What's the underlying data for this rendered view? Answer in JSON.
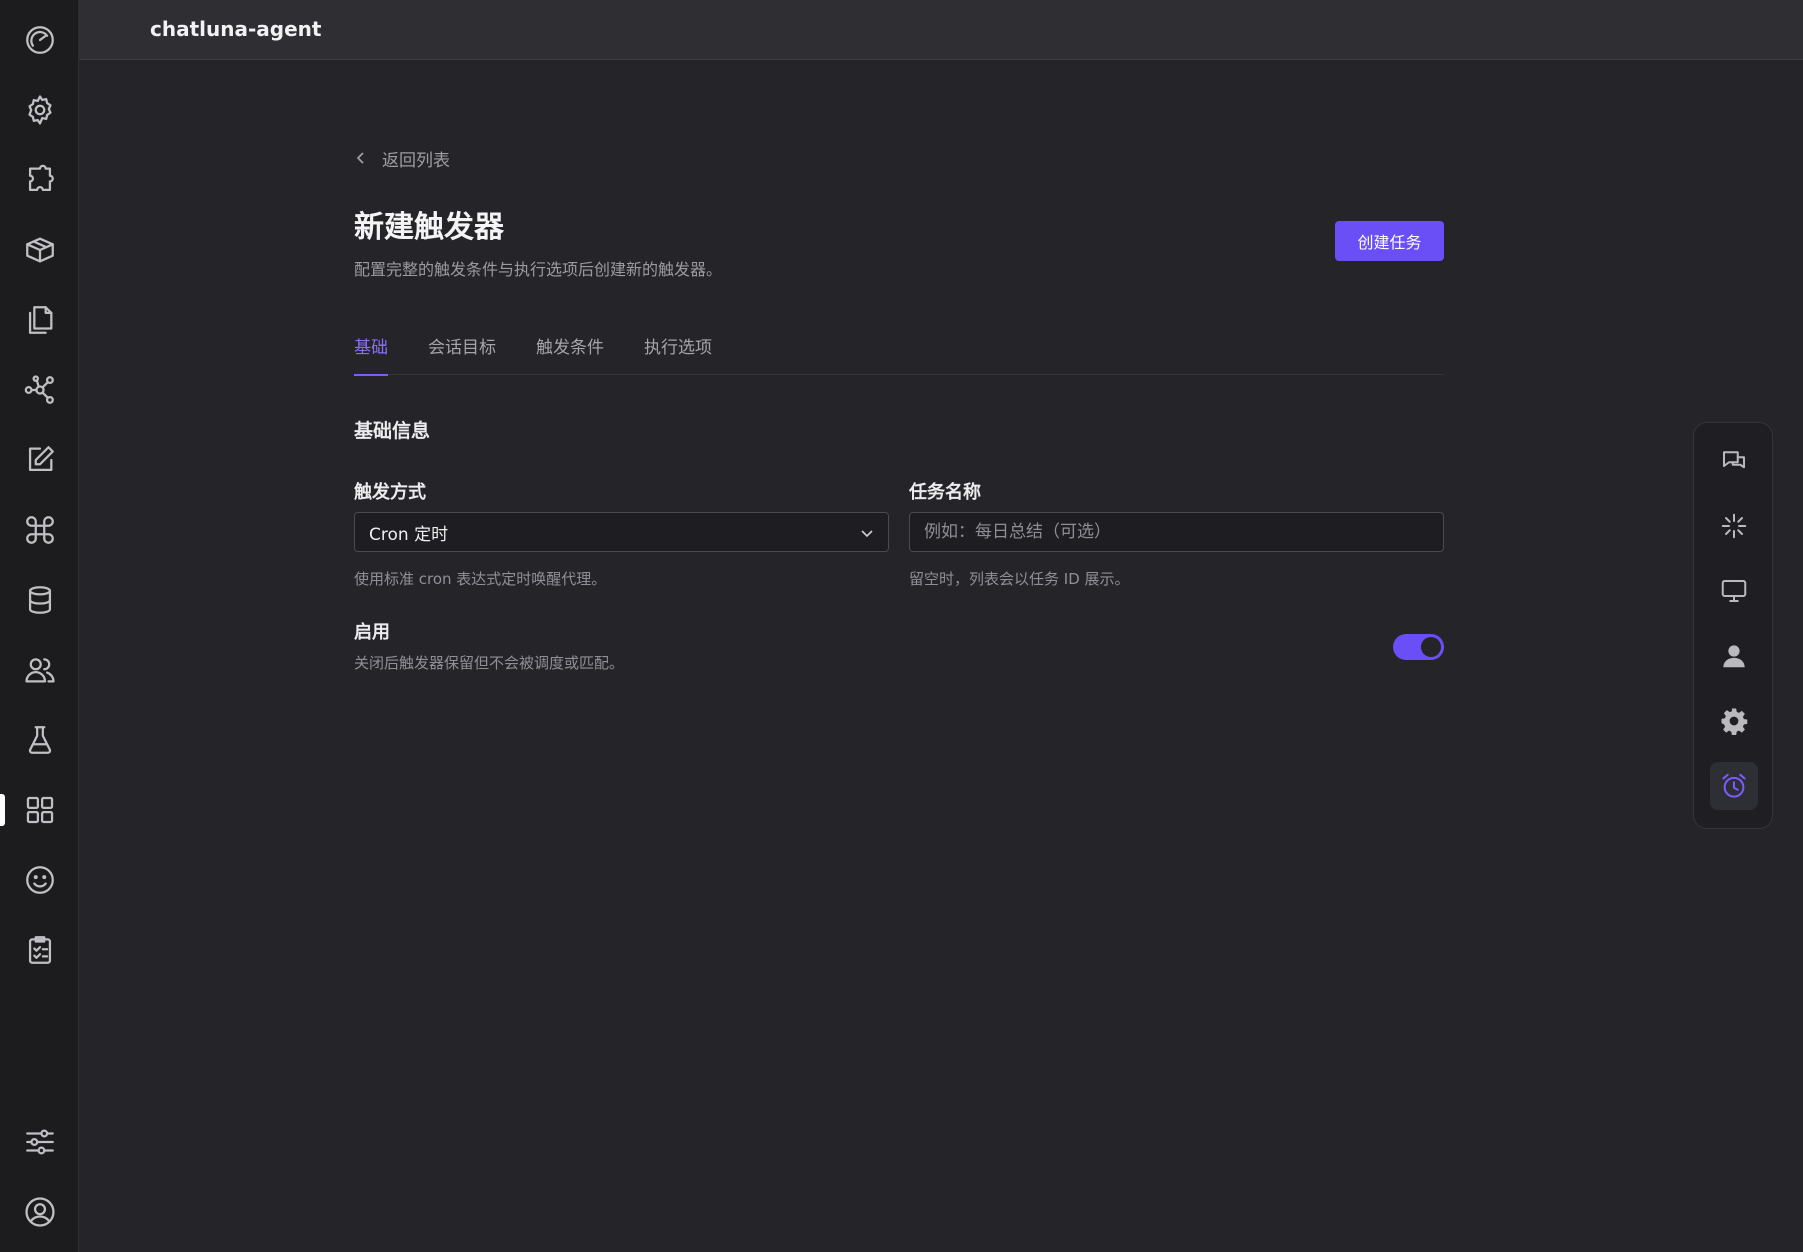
{
  "app": {
    "title": "chatluna-agent"
  },
  "activity_bar": {
    "items": [
      {
        "icon": "dashboard-icon"
      },
      {
        "icon": "gear-icon"
      },
      {
        "icon": "puzzle-icon"
      },
      {
        "icon": "box-icon"
      },
      {
        "icon": "files-icon"
      },
      {
        "icon": "network-icon"
      },
      {
        "icon": "edit-icon"
      },
      {
        "icon": "command-icon"
      },
      {
        "icon": "database-icon"
      },
      {
        "icon": "users-icon"
      },
      {
        "icon": "flask-icon"
      },
      {
        "icon": "apps-grid-icon",
        "active": true
      },
      {
        "icon": "smile-icon"
      },
      {
        "icon": "clipboard-check-icon"
      }
    ],
    "bottom_items": [
      {
        "icon": "sliders-icon"
      },
      {
        "icon": "user-circle-icon"
      }
    ]
  },
  "page": {
    "back_label": "返回列表",
    "title": "新建触发器",
    "description": "配置完整的触发条件与执行选项后创建新的触发器。",
    "create_button": "创建任务"
  },
  "tabs": [
    {
      "label": "基础",
      "active": true
    },
    {
      "label": "会话目标"
    },
    {
      "label": "触发条件"
    },
    {
      "label": "执行选项"
    }
  ],
  "section": {
    "title": "基础信息"
  },
  "fields": {
    "trigger_mode": {
      "label": "触发方式",
      "value": "Cron 定时",
      "help": "使用标准 cron 表达式定时唤醒代理。"
    },
    "task_name": {
      "label": "任务名称",
      "value": "",
      "placeholder": "例如：每日总结（可选）",
      "help": "留空时，列表会以任务 ID 展示。"
    }
  },
  "enable": {
    "label": "启用",
    "description": "关闭后触发器保留但不会被调度或匹配。",
    "on": true
  },
  "right_rail": {
    "items": [
      {
        "icon": "chat-bubbles-icon"
      },
      {
        "icon": "sparkle-icon"
      },
      {
        "icon": "monitor-icon"
      },
      {
        "icon": "person-icon"
      },
      {
        "icon": "settings-cog-icon"
      },
      {
        "icon": "alarm-clock-icon",
        "active": true
      }
    ]
  },
  "colors": {
    "accent": "#6b4ff6",
    "background": "#252529",
    "sidebar": "#1c1c1f"
  }
}
